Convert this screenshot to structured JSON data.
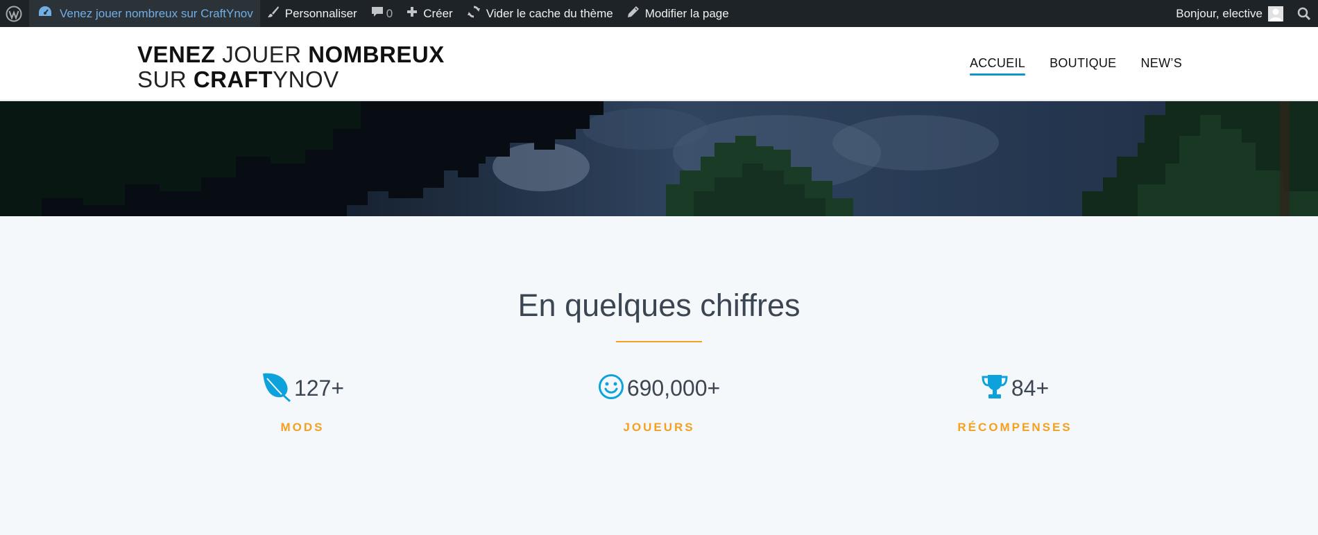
{
  "adminbar": {
    "site_name": "Venez jouer nombreux sur CraftYnov",
    "customize": "Personnaliser",
    "comments_count": "0",
    "new": "Créer",
    "clear_cache": "Vider le cache du thème",
    "edit_page": "Modifier la page",
    "greeting": "Bonjour, elective"
  },
  "header": {
    "title_line1_bold1": "VENEZ",
    "title_line1_thin": " JOUER ",
    "title_line1_bold2": "NOMBREUX",
    "title_line2_thin1": "SUR ",
    "title_line2_bold": "CRAFT",
    "title_line2_thin2": "YNOV",
    "nav": [
      {
        "label": "ACCUEIL",
        "active": true
      },
      {
        "label": "BOUTIQUE",
        "active": false
      },
      {
        "label": "NEW’S",
        "active": false
      }
    ]
  },
  "stats": {
    "title": "En quelques chiffres",
    "items": [
      {
        "icon": "leaf-icon",
        "value": "127+",
        "label": "MODS"
      },
      {
        "icon": "smiley-icon",
        "value": "690,000+",
        "label": "JOUEURS"
      },
      {
        "icon": "trophy-icon",
        "value": "84+",
        "label": "RÉCOMPENSES"
      }
    ]
  },
  "colors": {
    "adminbar_bg": "#1d2327",
    "link_blue": "#72aee6",
    "accent_orange": "#f4a020",
    "icon_blue": "#0ea2dc",
    "nav_underline": "#0e96c9"
  }
}
